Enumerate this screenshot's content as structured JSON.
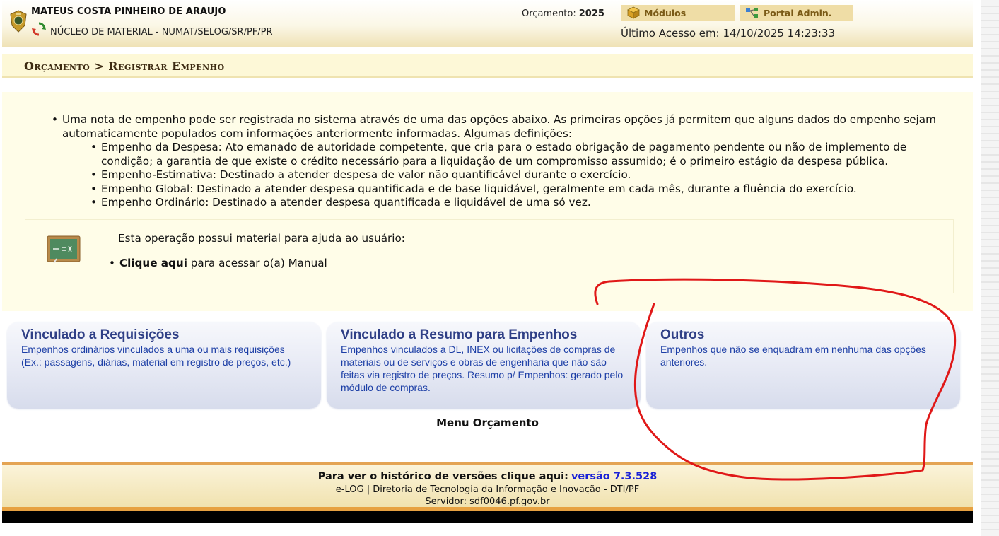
{
  "header": {
    "user_name": "MATEUS COSTA PINHEIRO DE ARAUJO",
    "unit": "NÚCLEO DE MATERIAL - NUMAT/SELOG/SR/PF/PR",
    "budget_label": "Orçamento:",
    "budget_year": "2025",
    "modules_button": "Módulos",
    "portal_button": "Portal Admin.",
    "last_access": "Último Acesso em: 14/10/2025 14:23:33",
    "icons": [
      "pf-badge-icon",
      "refresh-icon",
      "modules-cube-icon",
      "portal-network-icon"
    ]
  },
  "breadcrumb": {
    "text": "Orçamento > Registrar Empenho"
  },
  "info": {
    "intro": "Uma nota de empenho pode ser registrada no sistema através de uma das opções abaixo. As primeiras opções já permitem que alguns dados do empenho sejam automaticamente populados com informações anteriormente informadas. Algumas definições:",
    "definitions": [
      "Empenho da Despesa: Ato emanado de autoridade competente, que cria para o estado obrigação de pagamento pendente ou não de implemento de condição; a garantia de que existe o crédito necessário para a liquidação de um compromisso assumido; é o primeiro estágio da despesa pública.",
      "Empenho-Estimativa: Destinado a atender despesa de valor não quantificável durante o exercício.",
      "Empenho Global: Destinado a atender despesa quantificada e de base liquidável, geralmente em cada mês, durante a fluência do exercício.",
      "Empenho Ordinário: Destinado a atender despesa quantificada e liquidável de uma só vez."
    ]
  },
  "help": {
    "text": "Esta operação possui material para ajuda ao usuário:",
    "link_label": "Clique aqui",
    "link_suffix": " para acessar o(a) Manual"
  },
  "options": [
    {
      "title": "Vinculado a Requisições",
      "description": "Empenhos ordinários vinculados a uma ou mais requisições (Ex.: passagens, diárias, material em registro de preços, etc.)"
    },
    {
      "title": "Vinculado a Resumo para Empenhos",
      "description": "Empenhos vinculados a DL, INEX ou licitações de compras de materiais ou de serviços e obras de engenharia que não são feitas via registro de preços. Resumo p/ Empenhos: gerado pelo módulo de compras."
    },
    {
      "title": "Outros",
      "description": "Empenhos que não se enquadram em nenhuma das opções anteriores."
    }
  ],
  "menu_link": "Menu Orçamento",
  "footer": {
    "history_text": "Para ver o histórico de versões clique aqui:",
    "version": "versão 7.3.528",
    "credits": "e-LOG | Diretoria de Tecnologia da Informação e Inovação - DTI/PF",
    "server": "Servidor: sdf0046.pf.gov.br"
  },
  "colors": {
    "card_title": "#2f3f86",
    "card_desc": "#1d3fa6",
    "annotation": "#e01818",
    "footer_accent": "#e7a141"
  }
}
